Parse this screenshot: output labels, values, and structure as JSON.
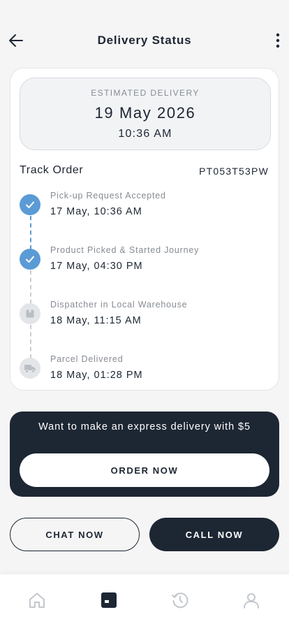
{
  "header": {
    "title": "Delivery Status",
    "back_icon": "arrow-left-icon",
    "more_icon": "more-vertical-icon"
  },
  "estimate": {
    "label": "ESTIMATED DELIVERY",
    "date": "19 May 2026",
    "time": "10:36 AM"
  },
  "track": {
    "title": "Track Order",
    "order_id": "PT053T53PW",
    "steps": [
      {
        "label": "Pick-up Request Accepted",
        "date": "17 May, 10:36 AM",
        "status": "done",
        "icon": "check-icon"
      },
      {
        "label": "Product Picked & Started Journey",
        "date": "17 May, 04:30 PM",
        "status": "done",
        "icon": "check-icon"
      },
      {
        "label": "Dispatcher in Local Warehouse",
        "date": "18 May, 11:15 AM",
        "status": "pending",
        "icon": "package-icon"
      },
      {
        "label": "Parcel Delivered",
        "date": "18 May, 01:28 PM",
        "status": "pending",
        "icon": "truck-icon"
      }
    ]
  },
  "promo": {
    "text": "Want to make an express delivery with $5",
    "button": "ORDER NOW"
  },
  "actions": {
    "chat": "CHAT NOW",
    "call": "CALL NOW"
  },
  "tabbar": {
    "items": [
      {
        "icon": "home-icon",
        "active": false
      },
      {
        "icon": "orders-icon",
        "active": true
      },
      {
        "icon": "history-icon",
        "active": false
      },
      {
        "icon": "profile-icon",
        "active": false
      }
    ]
  },
  "colors": {
    "primary": "#1d2633",
    "accent": "#5b9bd5",
    "muted": "#868b92",
    "background": "#f5f5f5"
  }
}
